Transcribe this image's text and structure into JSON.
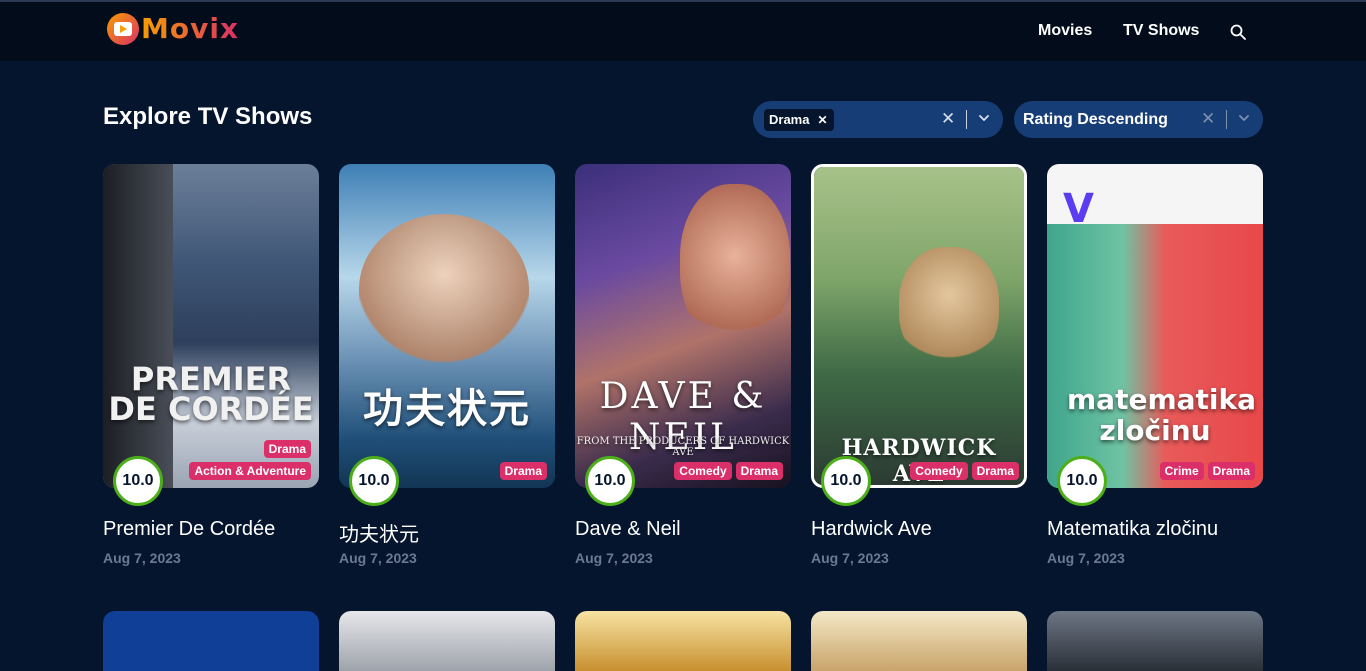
{
  "app": {
    "brand": "Movix"
  },
  "nav": {
    "movies": "Movies",
    "tv_shows": "TV Shows"
  },
  "page": {
    "title": "Explore TV Shows"
  },
  "filters": {
    "genre_chip": "Drama",
    "sort_value": "Rating Descending"
  },
  "shows": [
    {
      "title": "Premier De Cordée",
      "date": "Aug 7, 2023",
      "rating": "10.0",
      "genres": [
        "Drama",
        "Action & Adventure"
      ],
      "poster_text": "PREMIER DE CORDÉE"
    },
    {
      "title": "功夫状元",
      "date": "Aug 7, 2023",
      "rating": "10.0",
      "genres": [
        "Drama"
      ],
      "poster_text": "功夫状元"
    },
    {
      "title": "Dave & Neil",
      "date": "Aug 7, 2023",
      "rating": "10.0",
      "genres": [
        "Comedy",
        "Drama"
      ],
      "poster_text": "DAVE & NEIL",
      "poster_subtext": "FROM THE PRODUCERS OF HARDWICK AVE"
    },
    {
      "title": "Hardwick Ave",
      "date": "Aug 7, 2023",
      "rating": "10.0",
      "genres": [
        "Comedy",
        "Drama"
      ],
      "poster_text": "HARDWICK AVE"
    },
    {
      "title": "Matematika zločinu",
      "date": "Aug 7, 2023",
      "rating": "10.0",
      "genres": [
        "Crime",
        "Drama"
      ],
      "poster_text": "matematika zločinu"
    }
  ],
  "colors": {
    "accent": "#da2f68",
    "brand_orange": "#f89e00",
    "background": "#04152d",
    "rating_ring": "#4caf1a"
  }
}
